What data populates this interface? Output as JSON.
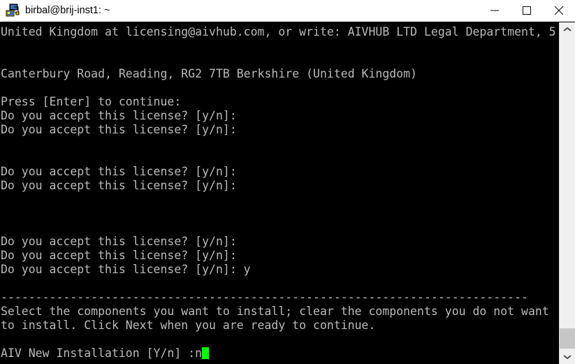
{
  "window": {
    "title": "birbal@brij-inst1: ~",
    "icon": "putty-computer-icon",
    "controls": {
      "minimize": "minimize-icon",
      "maximize": "maximize-icon",
      "close": "close-icon"
    },
    "colors": {
      "titlebar_bg": "#ffffff",
      "titlebar_text": "#000000",
      "terminal_bg": "#000000",
      "terminal_fg": "#bbbbbb",
      "cursor": "#00ff00",
      "scrollbar_track": "#f0f0f0",
      "scrollbar_thumb": "#c6c6c6"
    }
  },
  "terminal": {
    "lines": [
      "United Kingdom at licensing@aivhub.com, or write: AIVHUB LTD Legal Department, 5",
      "",
      "",
      "Canterbury Road, Reading, RG2 7TB Berkshire (United Kingdom)",
      "",
      "Press [Enter] to continue:",
      "Do you accept this license? [y/n]:",
      "Do you accept this license? [y/n]:",
      "",
      "",
      "Do you accept this license? [y/n]:",
      "Do you accept this license? [y/n]:",
      "",
      "",
      "",
      "Do you accept this license? [y/n]:",
      "Do you accept this license? [y/n]:",
      "Do you accept this license? [y/n]: y",
      "",
      "----------------------------------------------------------------------------",
      "Select the components you want to install; clear the components you do not want",
      "to install. Click Next when you are ready to continue.",
      "",
      "AIV New Installation [Y/n] :n"
    ],
    "prompt_line": "AIV New Installation [Y/n] :n",
    "cursor_char": " "
  },
  "scrollbar": {
    "up_arrow": "chevron-up-icon",
    "down_arrow": "chevron-down-icon"
  }
}
